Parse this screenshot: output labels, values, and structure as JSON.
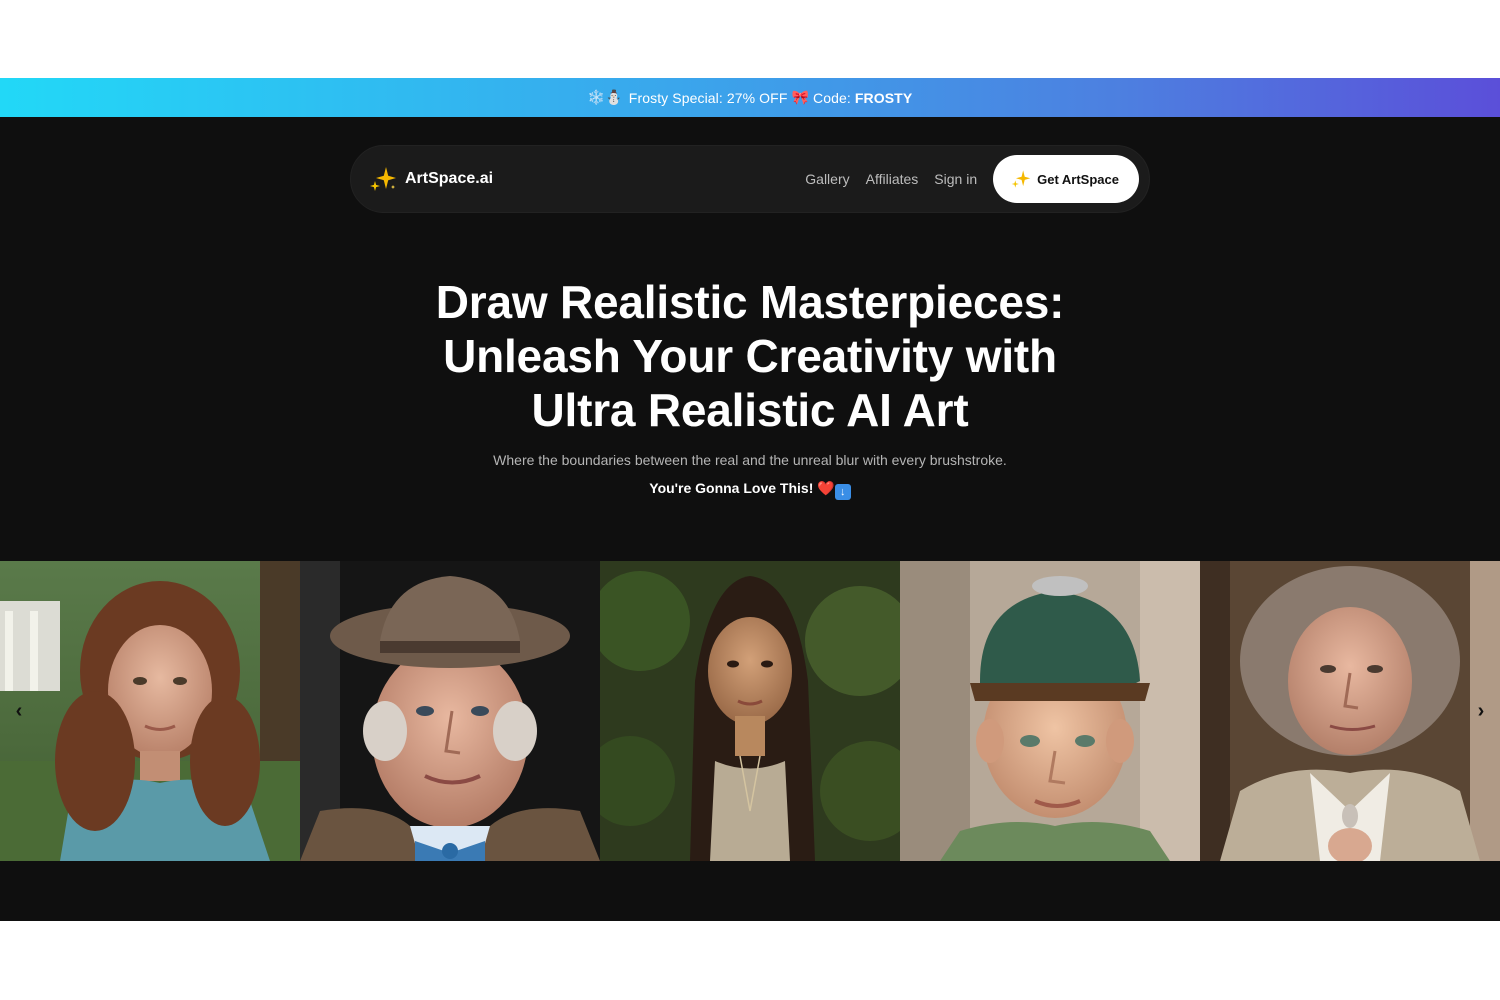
{
  "promo": {
    "emoji": "❄️⛄",
    "text": "Frosty Special: 27% OFF",
    "tie_emoji": "🎀",
    "code_label": "Code:",
    "code": "FROSTY"
  },
  "nav": {
    "brand": "ArtSpace.ai",
    "brand_icon": "sparkles-icon",
    "links": [
      "Gallery",
      "Affiliates",
      "Sign in"
    ],
    "cta_label": "Get ArtSpace"
  },
  "hero": {
    "title_line1": "Draw Realistic Masterpieces:",
    "title_line2": "Unleash Your Creativity with",
    "title_line3": "Ultra Realistic AI Art",
    "subtitle": "Where the boundaries between the real and the unreal blur with every brushstroke.",
    "love_text": "You're Gonna Love This!",
    "love_emoji": "❤️"
  },
  "carousel": {
    "prev": "‹",
    "next": "›",
    "portraits": [
      "woman-curly-hair-portrait",
      "elderly-man-hat-portrait",
      "young-woman-long-hair-portrait",
      "boy-green-cap-portrait",
      "elderly-woman-portrait"
    ]
  },
  "colors": {
    "background": "#0f0f0f",
    "promo_start": "#22d8f7",
    "promo_end": "#5b4fd9",
    "accent_star": "#f5b800"
  }
}
